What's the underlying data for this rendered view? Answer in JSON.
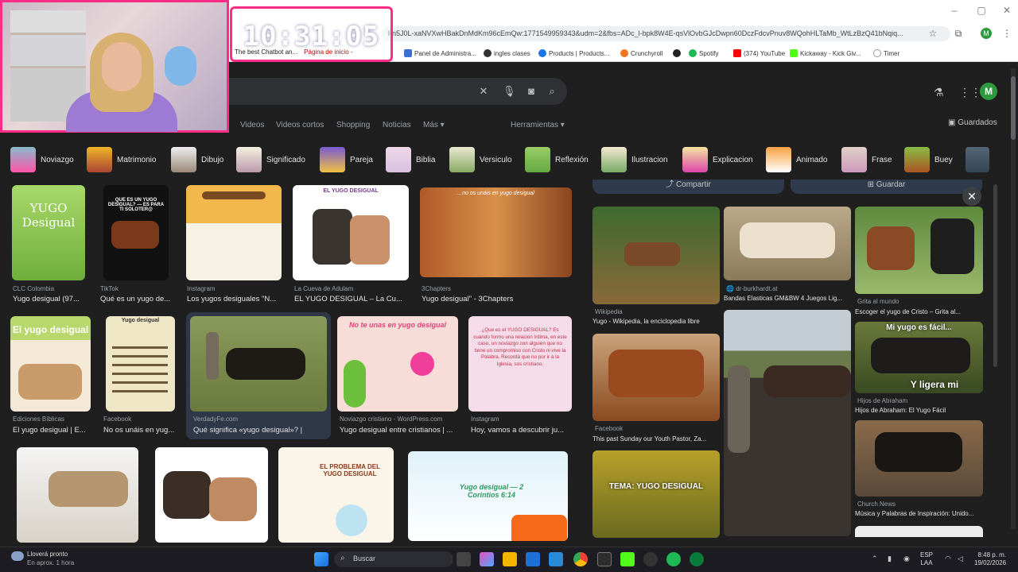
{
  "browser": {
    "url": "l-n5J0L-xaNVXwHBakDnMdKm96cEmQw:1771549959343&udm=2&fbs=ADc_l-bpk8W4E-qsVlOvbGJcDwpn60DczFdcvPnuv8WQohHLTaMb_WtLzBzQ41bNqiq...",
    "tab_peek": [
      "The best Chatbot an...",
      "Página de inicio -"
    ],
    "bookmarks": [
      "Panel de Administra...",
      "ingles clases",
      "Products | Products...",
      "Crunchyroll",
      "Spotify",
      "(374) YouTube",
      "Kickaway - Kick Giv...",
      "Timer"
    ],
    "profile_letter": "M"
  },
  "overlay": {
    "clock": "10:31:05"
  },
  "google": {
    "tabs": [
      "Videos",
      "Videos cortos",
      "Shopping",
      "Noticias",
      "Más"
    ],
    "tools": "Herramientas",
    "saved": "Guardados",
    "chips": [
      "Noviazgo",
      "Matrimonio",
      "Dibujo",
      "Significado",
      "Pareja",
      "Biblia",
      "Versiculo",
      "Reflexión",
      "Ilustracion",
      "Explicacion",
      "Animado",
      "Frase",
      "Buey"
    ]
  },
  "results": [
    {
      "source": "CLC Colombia",
      "title": "Yugo desigual (97...",
      "img_text": "YUGO Desigual"
    },
    {
      "source": "TikTok",
      "title": "Qué es un yugo de...",
      "img_text": "QUE ES UN YUGO DESIGUAL? — ES PARA TI SOLOTER@"
    },
    {
      "source": "Instagram",
      "title": "Los yugos desiguales \"N...",
      "img_text": ""
    },
    {
      "source": "La Cueva de Adulam",
      "title": "EL YUGO DESIGUAL – La Cu...",
      "img_text": "EL YUGO DESIGUAL"
    },
    {
      "source": "3Chapters",
      "title": "Yugo desigual\" - 3Chapters",
      "img_text": "...no os unáis en yugo desigual"
    },
    {
      "source": "Ediciones Bíblicas",
      "title": "El yugo desigual | E...",
      "img_text": "El yugo desigual"
    },
    {
      "source": "Facebook",
      "title": "No os unáis en yug...",
      "img_text": "Yugo desigual"
    },
    {
      "source": "VerdadyFe.com",
      "title": "Qué significa «yugo desigual»? |",
      "img_text": ""
    },
    {
      "source": "Noviazgo cristiano - WordPress.com",
      "title": "Yugo desigual entre cristianos | ...",
      "img_text": "No te unas en yugo desigual"
    },
    {
      "source": "Instagram",
      "title": "Hoy, vamos a descubrir ju...",
      "img_text": "¿Que es el YUGO DESIGUAL? Es cuando formo una relacion íntima, en este caso, un noviazgo con alguien que no tiene un compromiso con Cristo ni vive la Palabra. Recordá que no por ir a la Iglesia, sos cristiano."
    },
    {
      "source": "",
      "title": "",
      "img_text": ""
    },
    {
      "source": "",
      "title": "",
      "img_text": ""
    },
    {
      "source": "",
      "title": "",
      "img_text": "EL PROBLEMA DEL YUGO DESIGUAL"
    },
    {
      "source": "",
      "title": "",
      "img_text": "Yugo desigual — 2 Corintios 6:14"
    }
  ],
  "panel": {
    "share": "Compartir",
    "save": "Guardar",
    "related": [
      {
        "source": "Wikipedia",
        "title": "Yugo - Wikipedia, la enciclopedia libre"
      },
      {
        "source": "dr-burkhardt.at",
        "title": "Bandas Elasticas GM&BW 4 Juegos Lig..."
      },
      {
        "source": "Grita al mundo",
        "title": "Escoger el yugo de Cristo – Grita al..."
      },
      {
        "source": "Facebook",
        "title": "This past Sunday our Youth Pastor, Za..."
      },
      {
        "source": "Hijos de Abraham",
        "title": "Hijos de Abraham: El Yugo Fácil"
      },
      {
        "source": "Church News",
        "title": "Música y Palabras de Inspiración: Unido..."
      }
    ],
    "img_texts": [
      "Mi yugo es fácil...",
      "Y ligera mi",
      "TEMA: YUGO DESIGUAL"
    ]
  },
  "taskbar": {
    "weather_title": "Lloverá pronto",
    "weather_sub": "En aprox. 1 hora",
    "search_placeholder": "Buscar",
    "lang": "ESP",
    "lang_sub": "LAA",
    "time": "8:48 p. m.",
    "date": "19/02/2026"
  }
}
